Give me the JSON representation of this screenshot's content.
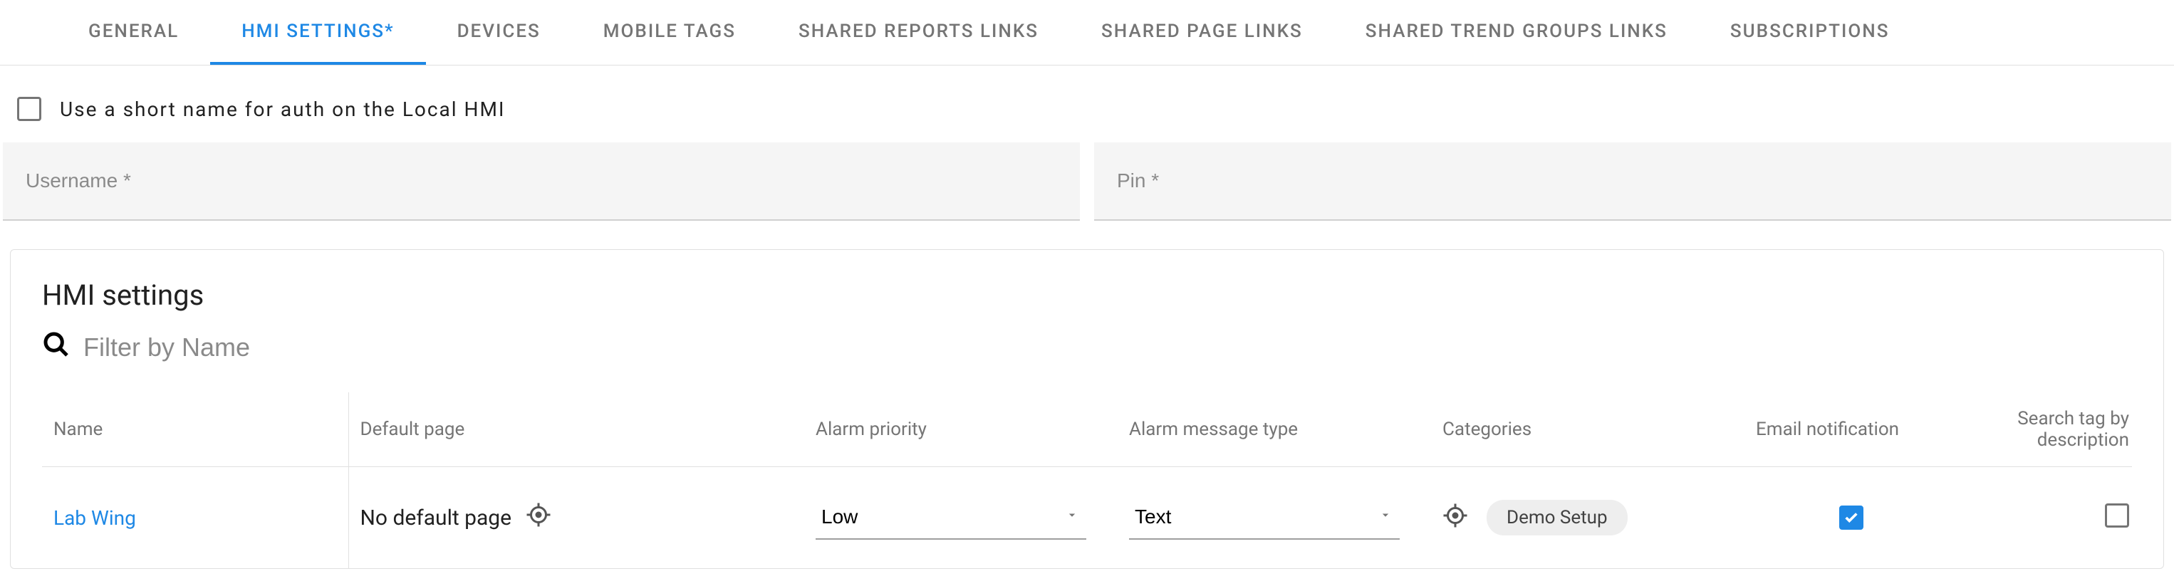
{
  "tabs": [
    {
      "label": "GENERAL"
    },
    {
      "label": "HMI SETTINGS*"
    },
    {
      "label": "DEVICES"
    },
    {
      "label": "MOBILE TAGS"
    },
    {
      "label": "SHARED REPORTS LINKS"
    },
    {
      "label": "SHARED PAGE LINKS"
    },
    {
      "label": "SHARED TREND GROUPS LINKS"
    },
    {
      "label": "SUBSCRIPTIONS"
    }
  ],
  "active_tab_index": 1,
  "shortname": {
    "label": "Use a short name for auth on the Local HMI",
    "checked": false
  },
  "creds": {
    "username_placeholder": "Username *",
    "pin_placeholder": "Pin *",
    "username_value": "",
    "pin_value": ""
  },
  "card": {
    "title": "HMI settings",
    "filter_placeholder": "Filter by Name",
    "filter_value": ""
  },
  "columns": {
    "name": "Name",
    "default_page": "Default page",
    "alarm_priority": "Alarm priority",
    "alarm_msg_type": "Alarm message type",
    "categories": "Categories",
    "email_notification": "Email notification",
    "search_tag": "Search tag by description"
  },
  "rows": [
    {
      "name": "Lab Wing",
      "default_page": "No default page",
      "alarm_priority": "Low",
      "alarm_msg_type": "Text",
      "categories": [
        "Demo Setup"
      ],
      "email_notification": true,
      "search_tag_by_description": false
    }
  ]
}
